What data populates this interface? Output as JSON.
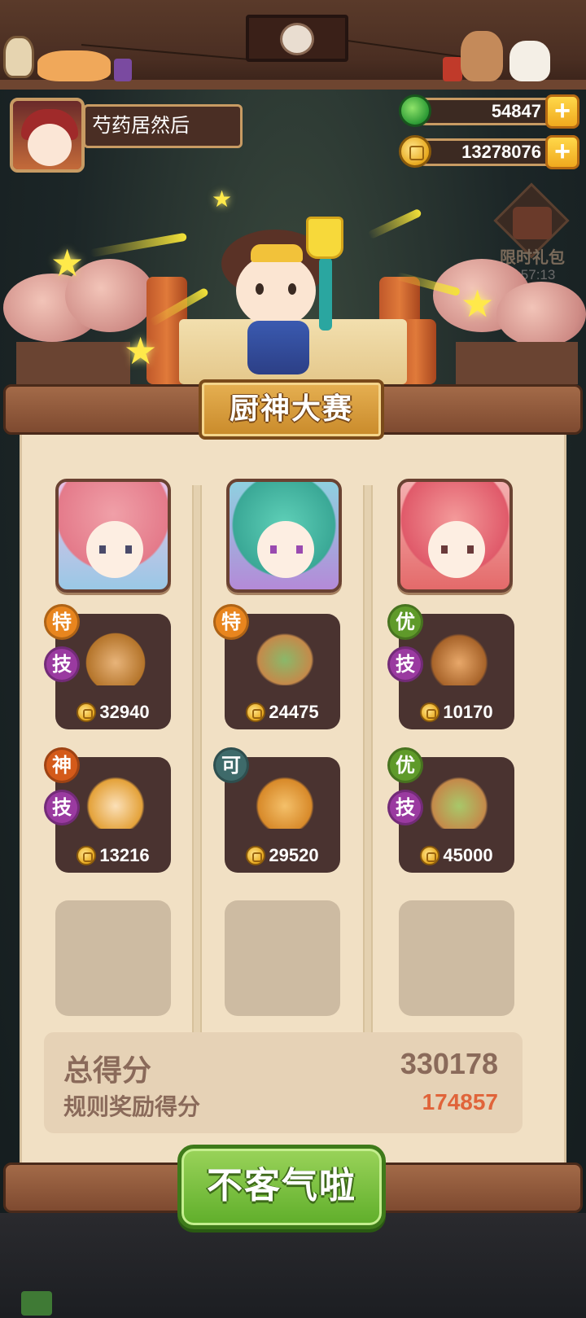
{
  "player": {
    "name": "芍药居然后"
  },
  "currency": {
    "jade": "54847",
    "coins": "13278076",
    "add_symbol": "+"
  },
  "gift": {
    "label": "限时礼包",
    "timer": "7:57:13"
  },
  "contest": {
    "title": "厨神大赛",
    "columns": [
      {
        "dishes": [
          {
            "grade": "特",
            "grade_color": "#e8851e",
            "skill": "技",
            "price": "32940"
          },
          {
            "grade": "神",
            "grade_color": "#d45a1a",
            "skill": "技",
            "price": "13216"
          }
        ]
      },
      {
        "dishes": [
          {
            "grade": "特",
            "grade_color": "#e8851e",
            "skill": "",
            "price": "24475"
          },
          {
            "grade": "可",
            "grade_color": "#3e6a6a",
            "skill": "",
            "price": "29520"
          }
        ]
      },
      {
        "dishes": [
          {
            "grade": "优",
            "grade_color": "#5f9a2a",
            "skill": "技",
            "price": "10170"
          },
          {
            "grade": "优",
            "grade_color": "#5f9a2a",
            "skill": "技",
            "price": "45000"
          }
        ]
      }
    ],
    "score": {
      "total_label": "总得分",
      "total_value": "330178",
      "bonus_label": "规则奖励得分",
      "bonus_value": "174857",
      "bonus_color": "#e0643a"
    },
    "confirm_label": "不客气啦"
  },
  "icons": {
    "jade": "jade-icon",
    "coin": "coin-icon",
    "plus": "plus-icon",
    "gift": "gift-chest-icon"
  }
}
